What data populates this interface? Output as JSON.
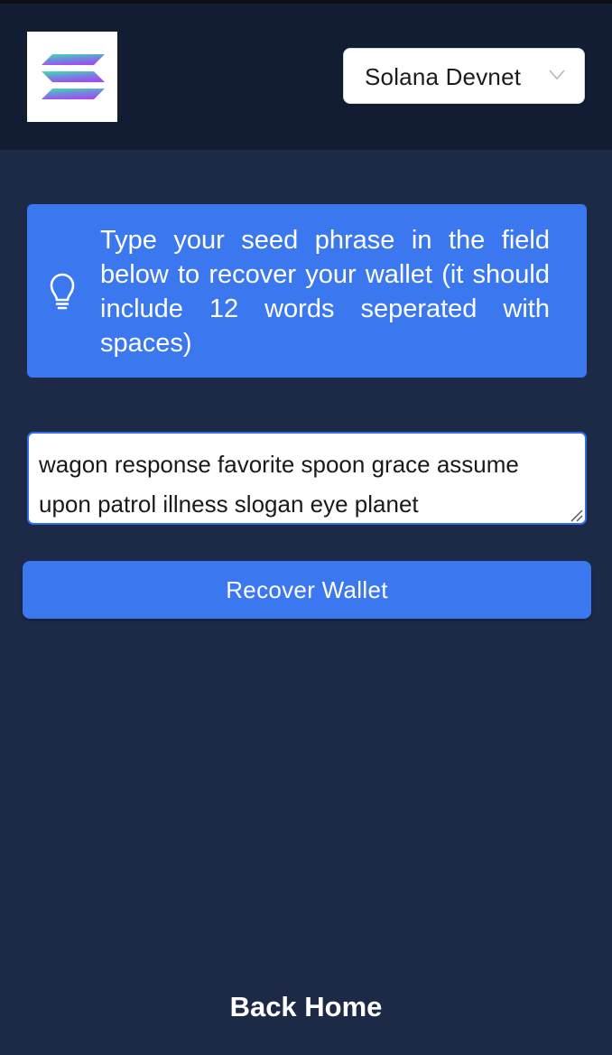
{
  "header": {
    "logo_icon": "solana-logo",
    "network_select": {
      "selected": "Solana Devnet",
      "chevron_icon": "chevron-down-icon"
    }
  },
  "info": {
    "icon": "lightbulb-icon",
    "message": "Type your seed phrase in the field below to recover your wallet (it should include 12 words seperated with spaces)"
  },
  "seed_phrase": {
    "value": "wagon response favorite spoon grace assume upon patrol illness slogan eye planet"
  },
  "recover_button": {
    "label": "Recover Wallet"
  },
  "back_home": {
    "label": "Back Home"
  },
  "colors": {
    "background": "#1c2a47",
    "header": "#121c32",
    "accent": "#3b78f0"
  }
}
